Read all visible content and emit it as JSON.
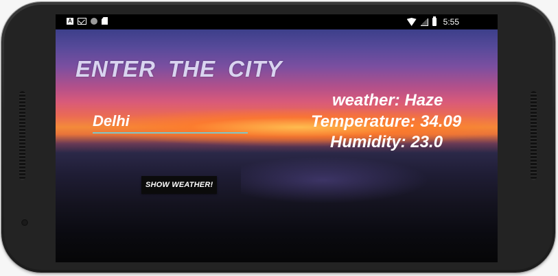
{
  "status_bar": {
    "time": "5:55",
    "left_icons": [
      "a-icon",
      "mail-icon",
      "circle-icon",
      "sd-card-icon"
    ],
    "right_icons": [
      "wifi-icon",
      "signal-icon",
      "battery-icon"
    ],
    "a_label": "A"
  },
  "app": {
    "title": "ENTER THE CITY",
    "city_input_value": "Delhi",
    "button_label": "SHOW WEATHER!",
    "weather_text": "weather: Haze",
    "temperature_text": "Temperature: 34.09",
    "humidity_text": "Humidity: 23.0"
  },
  "nav": {
    "icons": [
      "recents-square-icon",
      "home-circle-icon",
      "back-triangle-icon"
    ]
  },
  "colors": {
    "input_underline": "#7fc6c8",
    "title_color": "#d9d4f0",
    "button_bg": "#0b0b0b"
  }
}
